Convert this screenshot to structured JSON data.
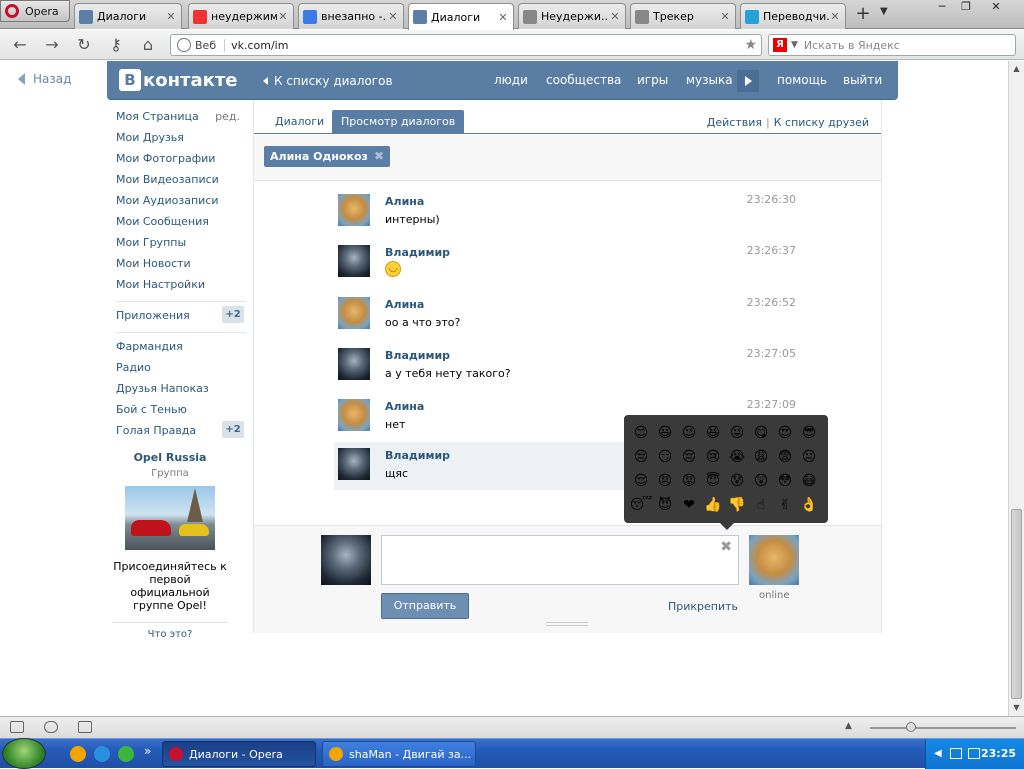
{
  "browser": {
    "menu_label": "Opera",
    "tabs": [
      {
        "title": "Диалоги",
        "favicon": "vk",
        "active": false
      },
      {
        "title": "неудержим...",
        "favicon": "yandex",
        "active": false
      },
      {
        "title": "внезапно -...",
        "favicon": "google",
        "active": false
      },
      {
        "title": "Диалоги",
        "favicon": "vk",
        "active": true
      },
      {
        "title": "Неудержи...",
        "favicon": "tracker",
        "active": false
      },
      {
        "title": "Трекер",
        "favicon": "tracker",
        "active": false
      },
      {
        "title": "Переводчи...",
        "favicon": "translate",
        "active": false
      }
    ],
    "address": {
      "prefix": "Веб",
      "url": "vk.com/im"
    },
    "search_placeholder": "Искать в Яндекс"
  },
  "vk": {
    "back_label": "Назад",
    "logo_text": "контакте",
    "logo_letter": "В",
    "header_back": "К списку диалогов",
    "nav": [
      "люди",
      "сообщества",
      "игры",
      "музыка",
      "помощь",
      "выйти"
    ],
    "left_menu": {
      "main": [
        "Моя Страница",
        "Мои Друзья",
        "Мои Фотографии",
        "Мои Видеозаписи",
        "Мои Аудиозаписи",
        "Мои Сообщения",
        "Мои Группы",
        "Мои Новости",
        "Мои Настройки"
      ],
      "edit_label": "ред.",
      "apps_label": "Приложения",
      "apps_badge": "+2",
      "apps": [
        "Фармандия",
        "Радио",
        "Друзья Напоказ",
        "Бой с Тенью",
        "Голая Правда"
      ],
      "last_badge": "+2"
    },
    "group": {
      "name": "Opel Russia",
      "type": "Группа",
      "text": "Присоединяйтесь к первой официальной группе Opel!",
      "what_label": "Что это?"
    },
    "im": {
      "tabs": [
        "Диалоги",
        "Просмотр диалогов"
      ],
      "actions": [
        "Действия",
        "К списку друзей"
      ],
      "actions_sep": "|",
      "peer_name": "Алина Однокоз",
      "messages": [
        {
          "author": "Алина",
          "text": "интерны)",
          "time": "23:26:30",
          "avatar": "alina"
        },
        {
          "author": "Владимир",
          "text": "",
          "emoji": "smile",
          "time": "23:26:37",
          "avatar": "vladimir"
        },
        {
          "author": "Алина",
          "text": "оо а что это?",
          "time": "23:26:52",
          "avatar": "alina"
        },
        {
          "author": "Владимир",
          "text": "а у тебя нету такого?",
          "time": "23:27:05",
          "avatar": "vladimir"
        },
        {
          "author": "Алина",
          "text": "нет",
          "time": "23:27:09",
          "avatar": "alina"
        },
        {
          "author": "Владимир",
          "text": "щяс",
          "time": "",
          "avatar": "vladimir",
          "highlight": true
        }
      ],
      "send_label": "Отправить",
      "attach_label": "Прикрепить",
      "peer_status": "online"
    },
    "emoji_popup": [
      "😊",
      "😃",
      "😉",
      "😆",
      "😜",
      "😋",
      "😍",
      "😎",
      "😒",
      "😏",
      "😔",
      "😢",
      "😭",
      "😩",
      "😨",
      "😐",
      "😌",
      "😠",
      "😡",
      "😇",
      "😰",
      "😲",
      "😳",
      "😷",
      "😴",
      "😈",
      "❤",
      "👍",
      "👎",
      "☝",
      "✌",
      "👌"
    ]
  },
  "statusbar": {
    "zoom_icon": "triangle-up"
  },
  "taskbar": {
    "tasks": [
      {
        "label": "Диалоги - Opera",
        "active": true
      },
      {
        "label": "shaMan - Двигай за...",
        "active": false
      }
    ],
    "clock": "23:25"
  }
}
